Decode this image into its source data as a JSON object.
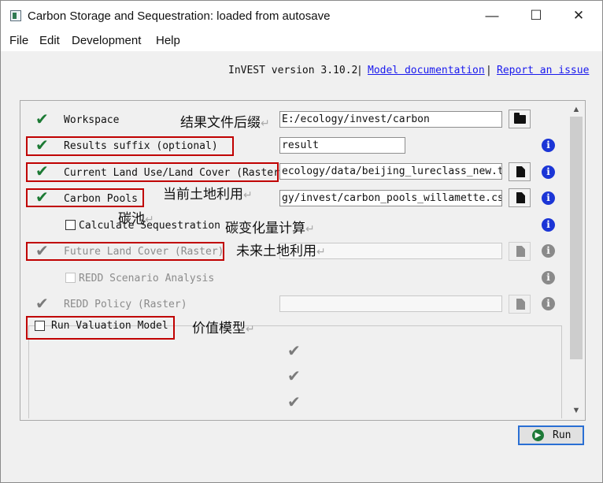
{
  "window": {
    "title": "Carbon Storage and Sequestration: loaded from autosave"
  },
  "titlebar_controls": {
    "minimize": "—",
    "maximize": "☐",
    "close": "✕"
  },
  "menu": [
    "File",
    "Edit",
    "Development",
    "Help"
  ],
  "header": {
    "version": "InVEST version 3.10.2",
    "separator": "|",
    "model_doc": "Model documentation",
    "report_issue": "Report an issue"
  },
  "form": {
    "workspace": {
      "label": "Workspace",
      "value": "E:/ecology/invest/carbon"
    },
    "results_suffix": {
      "label": "Results suffix (optional)",
      "value": "result"
    },
    "lulc_current": {
      "label": "Current Land Use/Land Cover (Raster)",
      "value": "ecology/data/beijing_lureclass_new.tif"
    },
    "carbon_pools": {
      "label": "Carbon Pools",
      "value": "gy/invest/carbon_pools_willamette.csv"
    },
    "calc_sequestration": {
      "label": "Calculate Sequestration"
    },
    "lulc_future": {
      "label": "Future Land Cover (Raster)",
      "value": ""
    },
    "redd_scenario": {
      "label": "REDD Scenario Analysis"
    },
    "redd_policy": {
      "label": "REDD Policy (Raster)",
      "value": ""
    },
    "run_valuation": {
      "label": "Run Valuation Model"
    }
  },
  "annotations": {
    "workspace": "结果文件后缀",
    "current_lulc": "当前土地利用",
    "carbon_pool": "碳池",
    "seq_calc": "碳变化量计算",
    "future_lulc": "未来土地利用",
    "valuation": "价值模型",
    "return_mark": "↵"
  },
  "icons": {
    "check": "✔",
    "info": "i",
    "run": "▶"
  },
  "run_button": {
    "label": "Run"
  },
  "colors": {
    "check_valid": "#1c7a34",
    "info_blue": "#1b35d6",
    "annotation_box": "#c00000",
    "link": "#1a1aee"
  }
}
